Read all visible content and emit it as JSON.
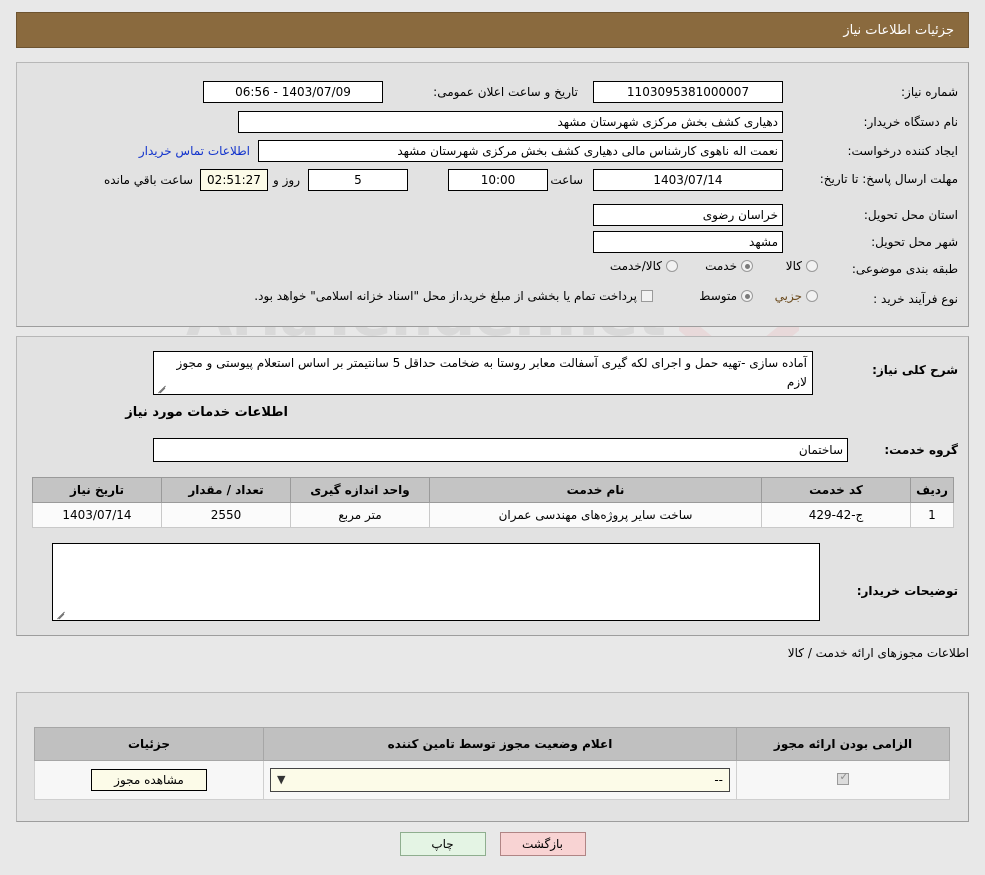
{
  "header": {
    "title": "جزئیات اطلاعات نیاز",
    "bg": "#8a6a3e"
  },
  "main_info": {
    "need_number_label": "شماره نیاز:",
    "need_number_value": "1103095381000007",
    "announce_datetime_label": "تاریخ و ساعت اعلان عمومی:",
    "announce_datetime_value": "1403/07/09 - 06:56",
    "buyer_org_label": "نام دستگاه خریدار:",
    "buyer_org_value": "دهیاری کشف بخش مرکزی شهرستان مشهد",
    "requester_label": "ایجاد کننده درخواست:",
    "requester_value": "نعمت اله ناهوی کارشناس مالی دهیاری کشف بخش مرکزی شهرستان مشهد",
    "contact_link": "اطلاعات تماس خریدار",
    "deadline_label": "مهلت ارسال پاسخ: تا تاریخ:",
    "deadline_date": "1403/07/14",
    "deadline_hour_label": "ساعت",
    "deadline_hour_value": "10:00",
    "remaining_days_value": "5",
    "remaining_days_label": "روز و",
    "remaining_time_value": "02:51:27",
    "remaining_suffix_label": "ساعت باقي مانده",
    "province_label": "استان محل تحویل:",
    "province_value": "خراسان رضوی",
    "city_label": "شهر محل تحویل:",
    "city_value": "مشهد",
    "category_label": "طبقه بندی موضوعی:",
    "category_options": [
      {
        "label": "کالا",
        "selected": false
      },
      {
        "label": "خدمت",
        "selected": true
      },
      {
        "label": "کالا/خدمت",
        "selected": false
      }
    ],
    "process_label": "نوع فرآیند خرید :",
    "process_options": [
      {
        "label": "جزیي",
        "selected": true
      },
      {
        "label": "متوسط",
        "selected": false
      }
    ],
    "treasury_checkbox_checked": false,
    "treasury_note": "پرداخت تمام یا بخشی از مبلغ خرید،از محل \"اسناد خزانه اسلامی\" خواهد بود."
  },
  "detail": {
    "need_desc_label": "شرح کلی نیاز:",
    "need_desc_value": "آماده سازی -تهیه حمل و اجرای لکه گیری آسفالت معابر روستا به ضخامت حداقل 5 سانتیمتر بر اساس استعلام پیوستی و مجوز لازم",
    "services_heading": "اطلاعات خدمات مورد نیاز",
    "service_group_label": "گروه خدمت:",
    "service_group_value": "ساختمان",
    "table_headers": [
      "ردیف",
      "کد خدمت",
      "نام خدمت",
      "واحد اندازه گیری",
      "تعداد / مقدار",
      "تاریخ نیاز"
    ],
    "table_rows": [
      {
        "row": "1",
        "code": "ج-42-429",
        "name": "ساخت سایر پروژه‌های مهندسی عمران",
        "unit": "متر مربع",
        "quantity": "2550",
        "date": "1403/07/14"
      }
    ],
    "buyer_notes_label": "توضیحات خریدار:",
    "buyer_notes_value": ""
  },
  "permits": {
    "section_note": "اطلاعات مجوزهای ارائه خدمت / کالا",
    "table_headers": [
      "الزامی بودن ارائه مجوز",
      "اعلام وضعیت مجوز توسط تامین کننده",
      "جزئیات"
    ],
    "rows": [
      {
        "required_checked": true,
        "status_value": "--",
        "details_button": "مشاهده مجوز"
      }
    ]
  },
  "footer": {
    "print_label": "چاپ",
    "back_label": "بازگشت"
  },
  "watermark": {
    "text": "AriaTender.net"
  }
}
